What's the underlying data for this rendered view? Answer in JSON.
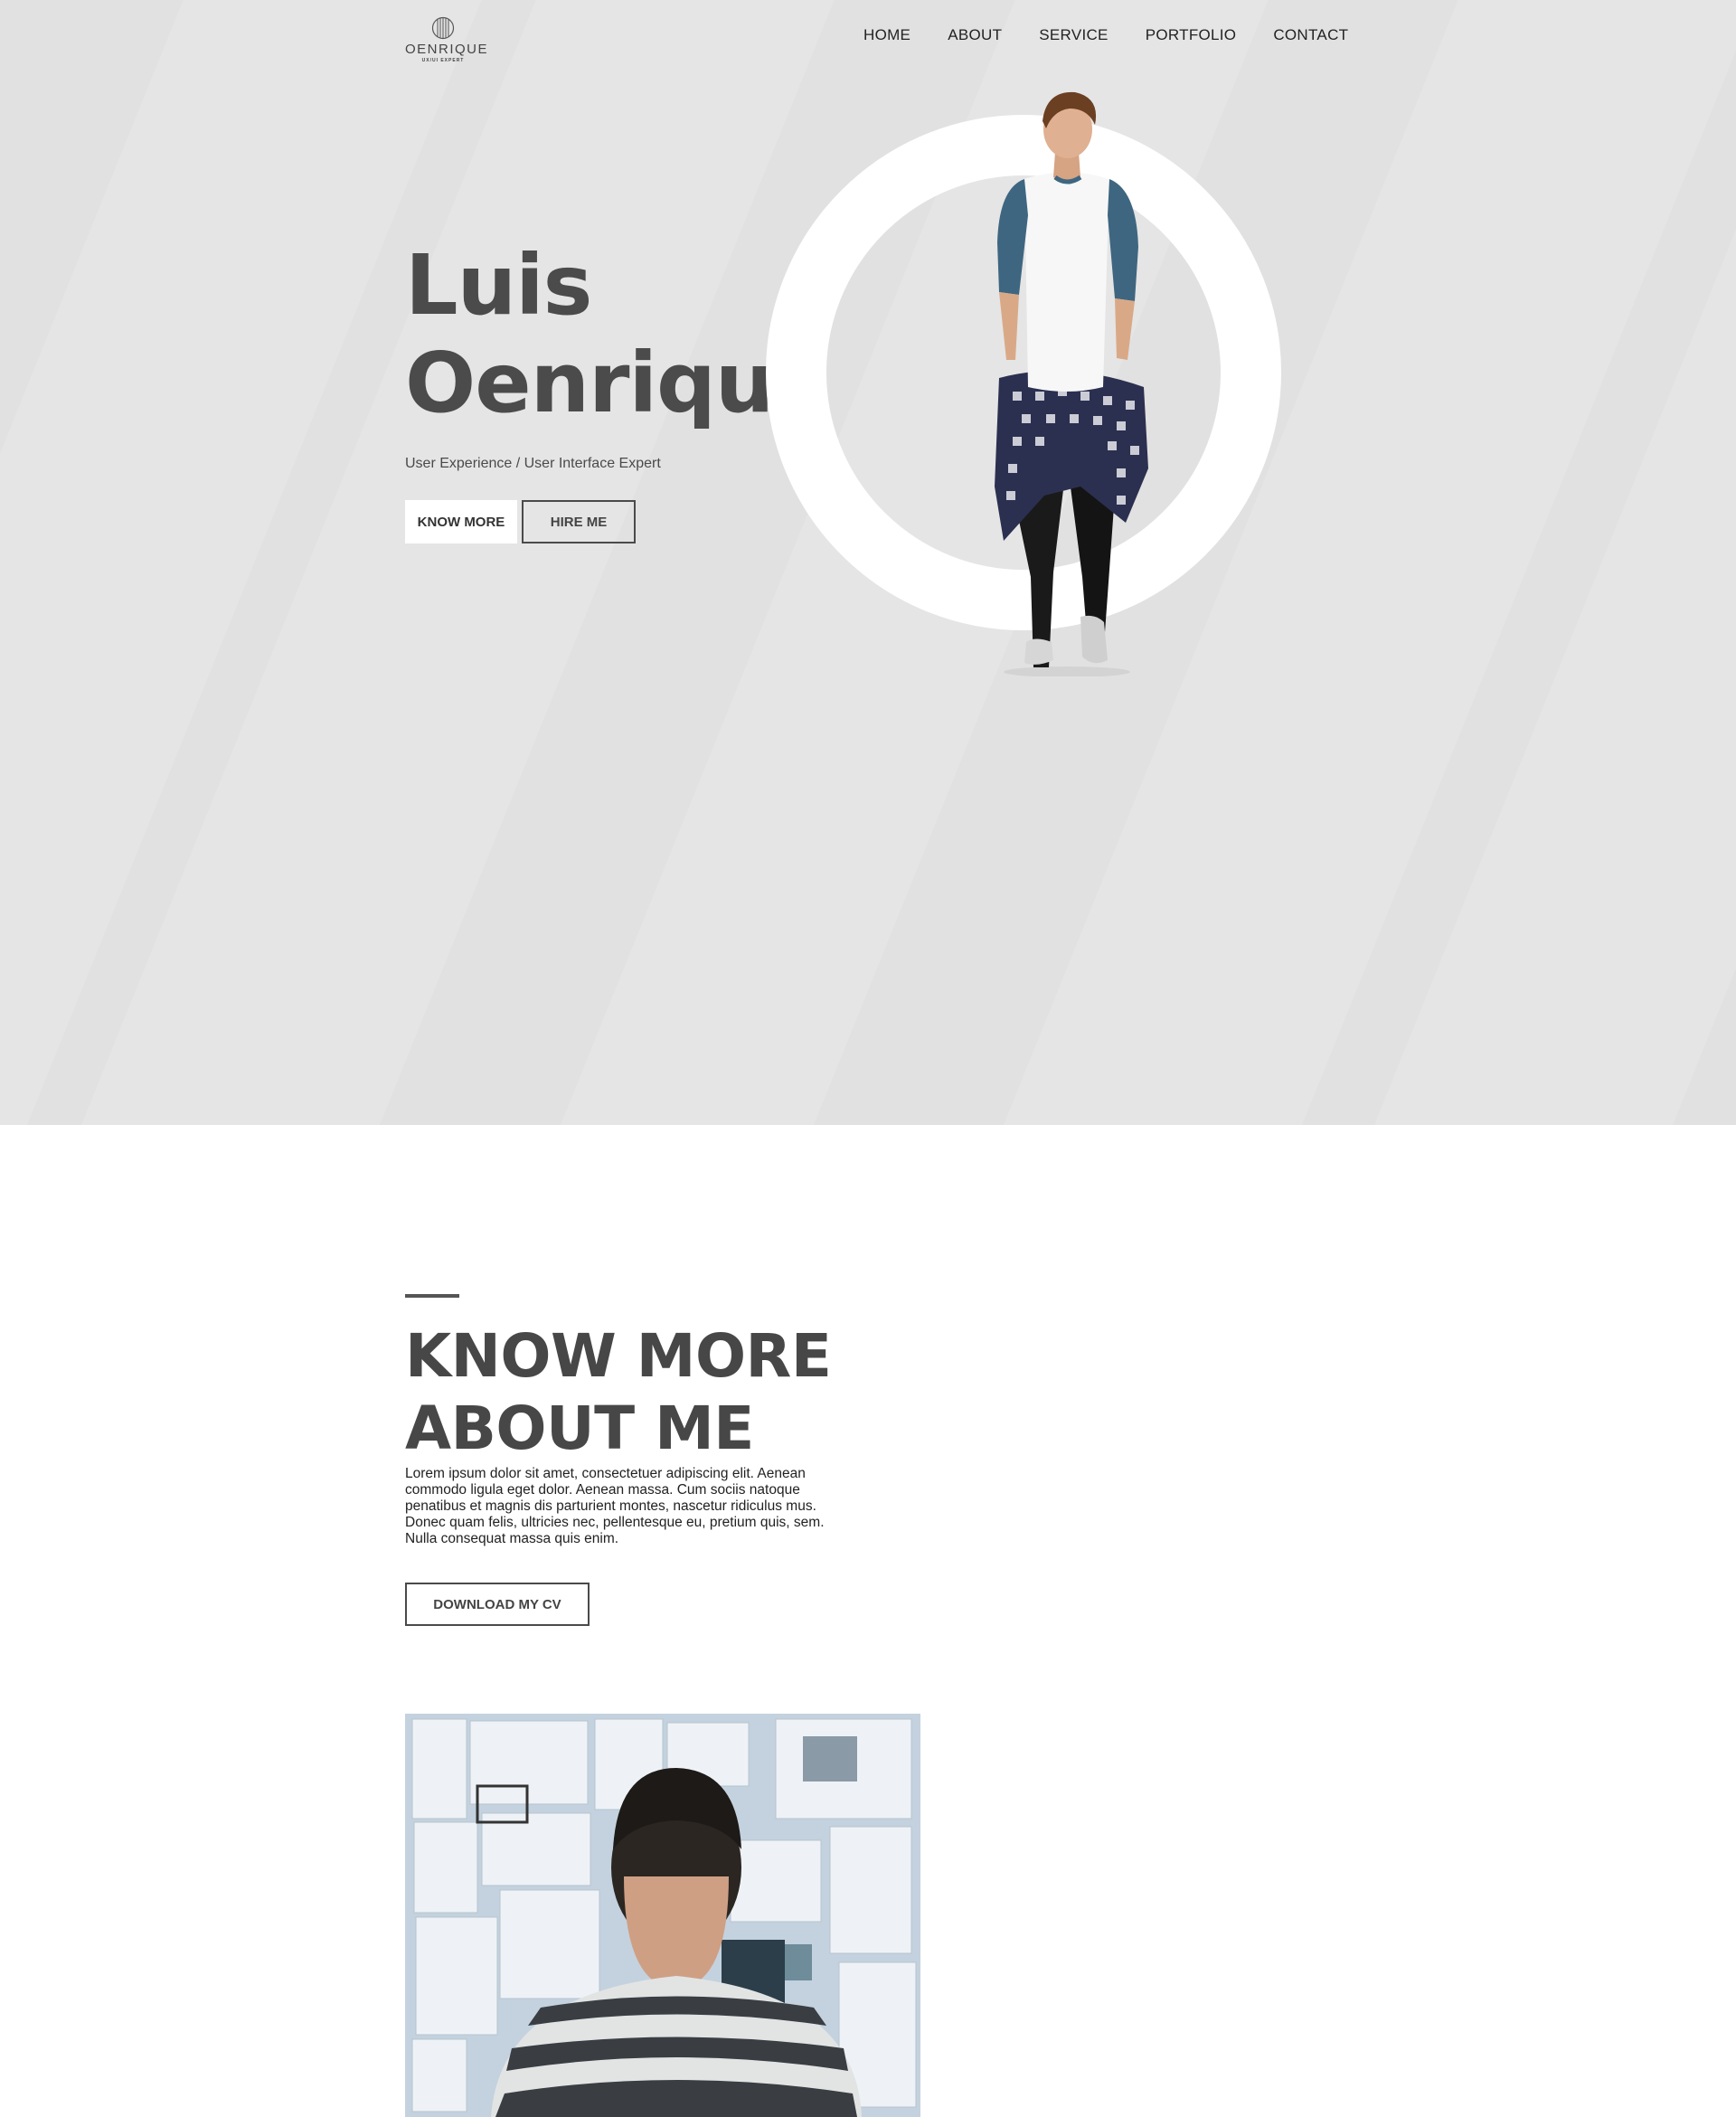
{
  "brand": {
    "name": "OENRIQUE",
    "tagline": "UX/UI EXPERT"
  },
  "nav": {
    "items": [
      "HOME",
      "ABOUT",
      "SERVICE",
      "PORTFOLIO",
      "CONTACT"
    ]
  },
  "hero": {
    "first_name": "Luis",
    "last_name": "Oenrique",
    "subtitle": "User Experience / User Interface Expert",
    "know_more_label": "KNOW MORE",
    "hire_me_label": "HIRE ME"
  },
  "about": {
    "title_line1": "KNOW MORE",
    "title_line2": "ABOUT ME",
    "text": "Lorem ipsum dolor sit amet, consectetuer adipiscing elit. Aenean commodo ligula eget dolor. Aenean massa. Cum sociis natoque penatibus et magnis dis parturient montes, nascetur ridiculus mus. Donec quam felis, ultricies nec, pellentesque eu, pretium quis, sem. Nulla consequat massa quis enim.",
    "cv_button_label": "DOWNLOAD MY CV"
  },
  "colors": {
    "hero_bg": "#e1e1e1",
    "heading": "#4b4b4b",
    "ring": "#ffffff",
    "sleeve": "#3e6680"
  }
}
